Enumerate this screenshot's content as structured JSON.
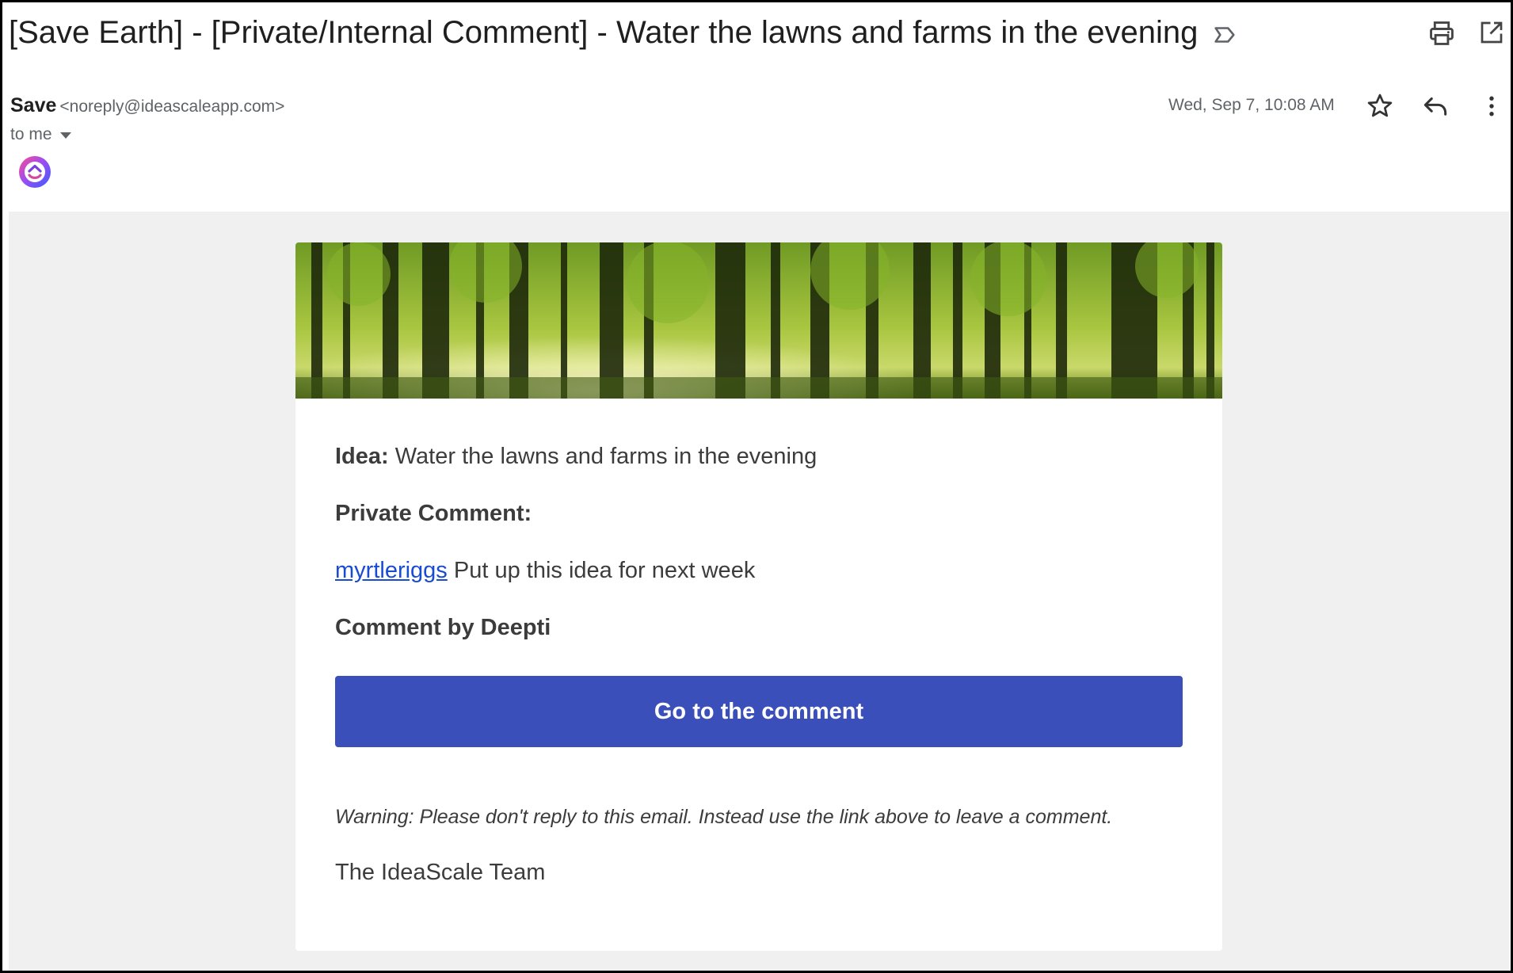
{
  "email": {
    "subject": "[Save Earth] - [Private/Internal Comment] - Water the lawns and farms in the evening",
    "sender_name": "Save",
    "sender_email": "<noreply@ideascaleapp.com>",
    "recipient": "to me",
    "date": "Wed, Sep 7, 10:08 AM"
  },
  "icons": {
    "label": "label-important-icon",
    "print": "print-icon",
    "popout": "open-in-new-window-icon",
    "star": "star-icon",
    "reply": "reply-icon",
    "more": "more-vertical-icon",
    "avatar": "ideascale-logo"
  },
  "body": {
    "idea_label": "Idea:",
    "idea_text": "Water the lawns and farms in the evening",
    "private_comment_label": "Private Comment:",
    "mention": "myrtleriggs",
    "comment_text": "Put up this idea for next week",
    "comment_by": "Comment by Deepti",
    "cta_label": "Go to the comment",
    "warning": "Warning: Please don't reply to this email. Instead use the link above to leave a comment.",
    "signature": "The IdeaScale Team"
  },
  "colors": {
    "cta_bg": "#3b4fbb",
    "link": "#1a4cd1",
    "mail_bg": "#f0f0f0"
  }
}
